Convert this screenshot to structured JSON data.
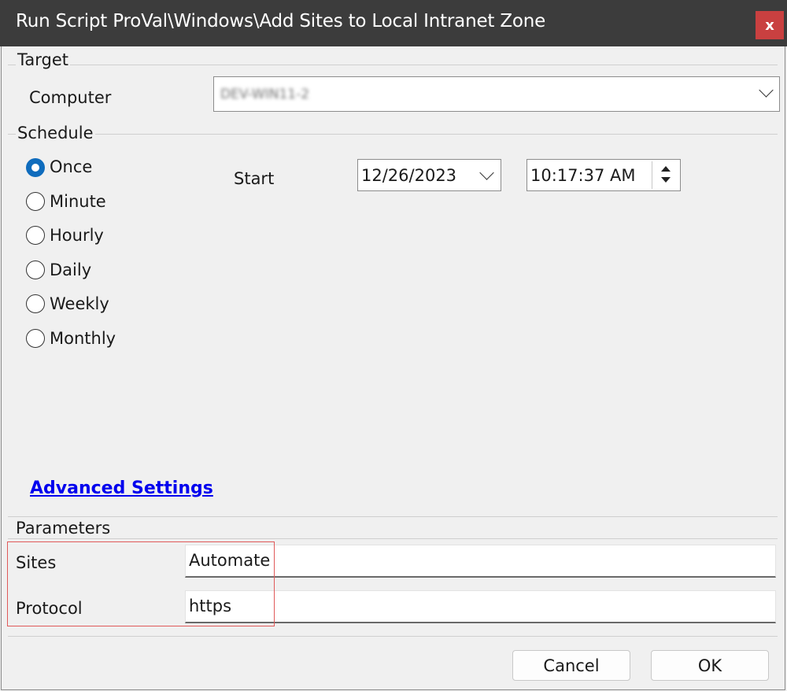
{
  "window": {
    "title": "Run Script ProVal\\Windows\\Add Sites to Local Intranet Zone",
    "close_label": "x"
  },
  "target": {
    "section_label": "Target",
    "computer_label": "Computer",
    "computer_value": "DEV-WIN11-2"
  },
  "schedule": {
    "section_label": "Schedule",
    "options": [
      {
        "label": "Once",
        "selected": true
      },
      {
        "label": "Minute",
        "selected": false
      },
      {
        "label": "Hourly",
        "selected": false
      },
      {
        "label": "Daily",
        "selected": false
      },
      {
        "label": "Weekly",
        "selected": false
      },
      {
        "label": "Monthly",
        "selected": false
      }
    ],
    "start_label": "Start",
    "start_date": "12/26/2023",
    "start_time": "10:17:37 AM",
    "advanced_link": "Advanced Settings"
  },
  "parameters": {
    "section_label": "Parameters",
    "sites_label": "Sites",
    "sites_value": "Automate",
    "protocol_label": "Protocol",
    "protocol_value": "https"
  },
  "footer": {
    "cancel_label": "Cancel",
    "ok_label": "OK"
  },
  "colors": {
    "titlebar": "#3c3c3c",
    "close": "#c94040",
    "radio_selected": "#0f6cbd",
    "link": "#0000ee",
    "highlight_box": "#e05a5a"
  }
}
